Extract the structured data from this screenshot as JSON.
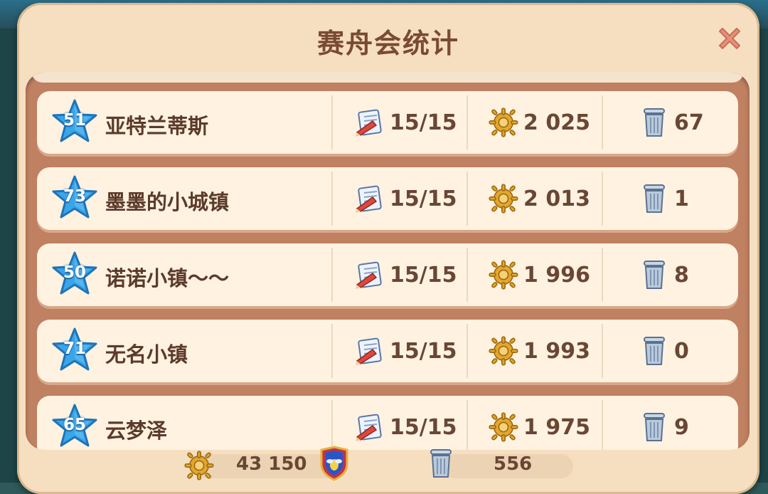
{
  "title": "赛舟会统计",
  "rows": [
    {
      "level": "51",
      "name": "亚特兰蒂斯",
      "tasks": "15/15",
      "score": "2 025",
      "trash": "67"
    },
    {
      "level": "73",
      "name": "墨墨的小城镇",
      "tasks": "15/15",
      "score": "2 013",
      "trash": "1"
    },
    {
      "level": "50",
      "name": "诺诺小镇～～",
      "tasks": "15/15",
      "score": "1 996",
      "trash": "8"
    },
    {
      "level": "71",
      "name": "无名小镇",
      "tasks": "15/15",
      "score": "1 993",
      "trash": "0"
    },
    {
      "level": "65",
      "name": "云梦泽",
      "tasks": "15/15",
      "score": "1 975",
      "trash": "9"
    }
  ],
  "footer": {
    "total_score": "43 150",
    "total_trash": "556"
  },
  "icons": {
    "level": "blue-star-icon",
    "tasks": "task-paper-pencil-icon",
    "score": "ship-wheel-icon",
    "trash": "trash-can-icon",
    "guild": "guild-shield-icon",
    "close": "close-icon"
  },
  "colors": {
    "panel": "#f6dfc0",
    "title": "#7a4a33",
    "close": "#e08a6a",
    "star": "#3aa6ea"
  }
}
